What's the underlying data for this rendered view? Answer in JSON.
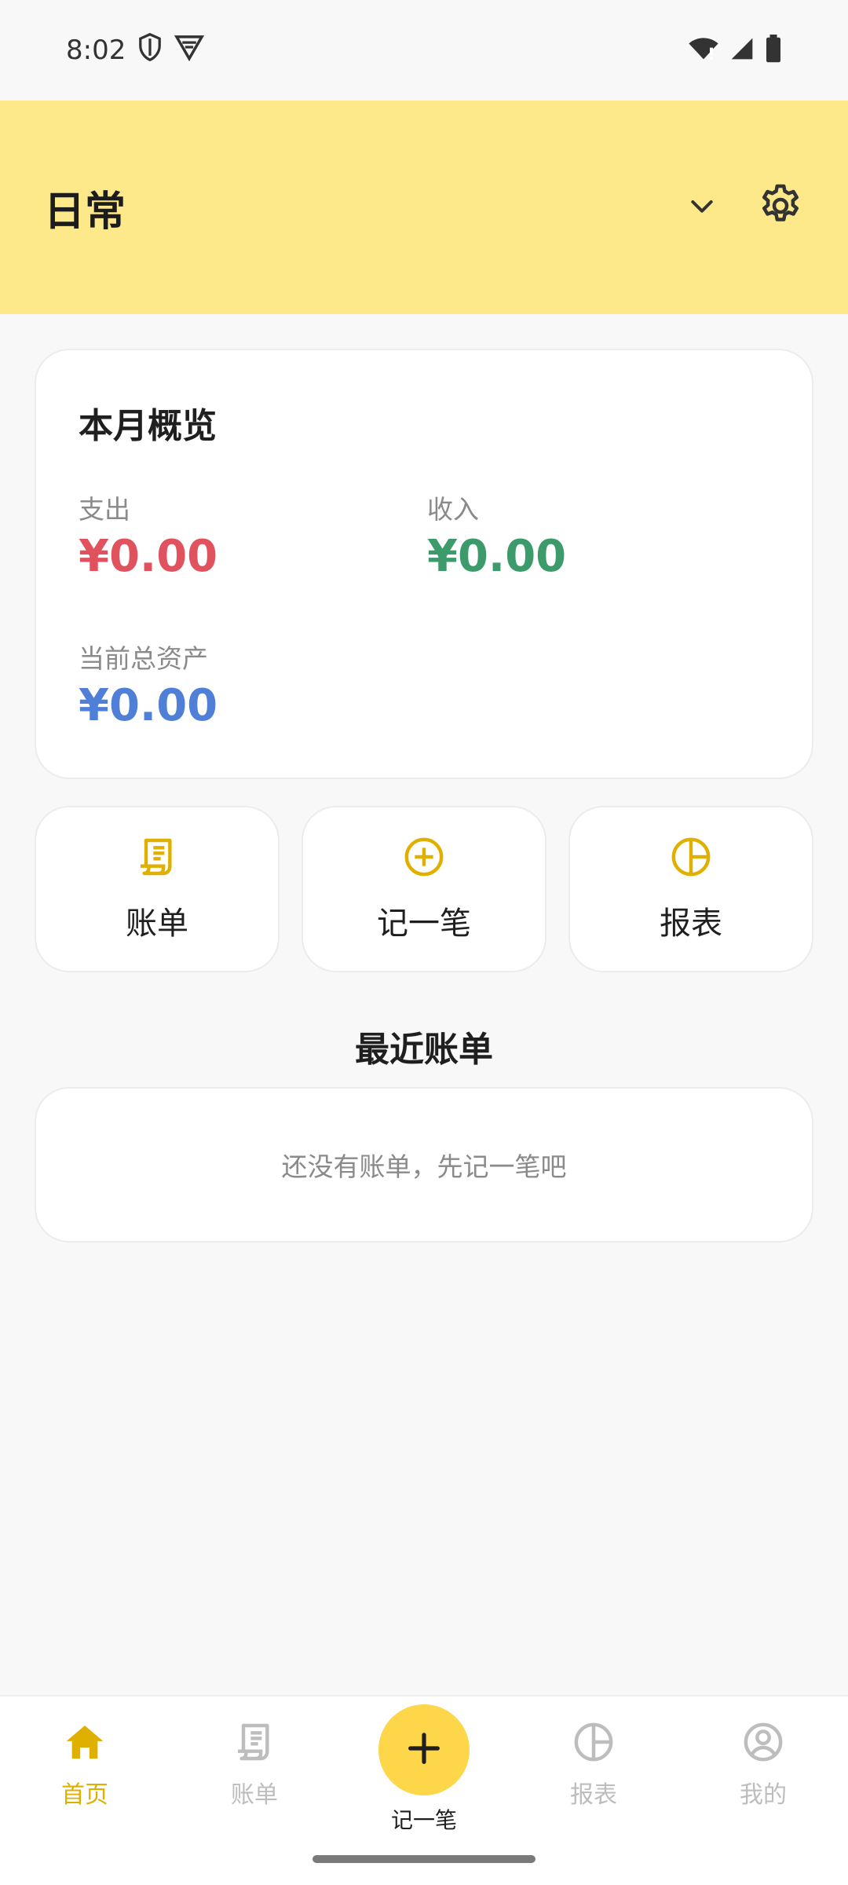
{
  "status": {
    "time": "8:02"
  },
  "header": {
    "title": "日常"
  },
  "overview": {
    "title": "本月概览",
    "expense_label": "支出",
    "expense_value": "¥0.00",
    "income_label": "收入",
    "income_value": "¥0.00",
    "assets_label": "当前总资产",
    "assets_value": "¥0.00"
  },
  "quick_actions": [
    {
      "label": "账单",
      "icon": "receipt-icon"
    },
    {
      "label": "记一笔",
      "icon": "add-circle-icon"
    },
    {
      "label": "报表",
      "icon": "pie-chart-icon"
    }
  ],
  "recent": {
    "title": "最近账单",
    "empty_text": "还没有账单，先记一笔吧"
  },
  "tabbar": {
    "items": [
      {
        "label": "首页",
        "icon": "home-icon",
        "active": true
      },
      {
        "label": "账单",
        "icon": "receipt-icon",
        "active": false
      },
      {
        "label": "记一笔",
        "icon": "plus-icon",
        "active": false
      },
      {
        "label": "报表",
        "icon": "pie-chart-icon",
        "active": false
      },
      {
        "label": "我的",
        "icon": "profile-icon",
        "active": false
      }
    ]
  },
  "colors": {
    "accent": "#fdd64a",
    "header_bg": "#fee98a",
    "expense": "#e0525e",
    "income": "#3d9b6b",
    "assets": "#4f7fd6",
    "icon_accent": "#e0b000"
  }
}
